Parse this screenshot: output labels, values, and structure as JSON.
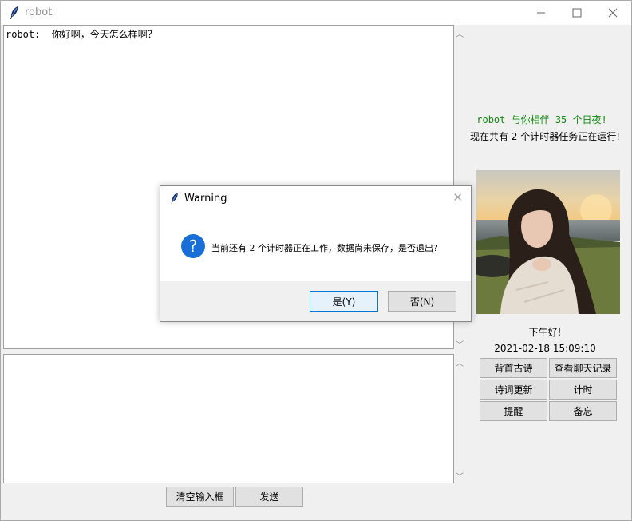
{
  "window": {
    "title": "robot"
  },
  "chat": {
    "first_line": "robot:  你好啊，今天怎么样啊？"
  },
  "sidebar": {
    "days_line": "robot 与你相伴 35 个日夜!",
    "timers_line": "现在共有 2 个计时器任务正在运行!",
    "greeting": "下午好!",
    "datetime": "2021-02-18 15:09:10",
    "buttons": [
      "背首古诗",
      "查看聊天记录",
      "诗词更新",
      "计时",
      "提醒",
      "备忘"
    ]
  },
  "bottom_buttons": {
    "clear": "清空输入框",
    "send": "发送"
  },
  "dialog": {
    "title": "Warning",
    "message": "当前还有 2 个计时器正在工作，数据尚未保存，是否退出?",
    "yes": "是(Y)",
    "no": "否(N)"
  },
  "colors": {
    "green_text": "#0f8a0f",
    "accent_blue": "#0066cc",
    "dialog_icon": "#1a6fd6"
  },
  "icons": {
    "app": "feather-icon",
    "minimize": "minimize-icon",
    "maximize": "maximize-icon",
    "close": "close-icon",
    "question": "question-icon"
  }
}
